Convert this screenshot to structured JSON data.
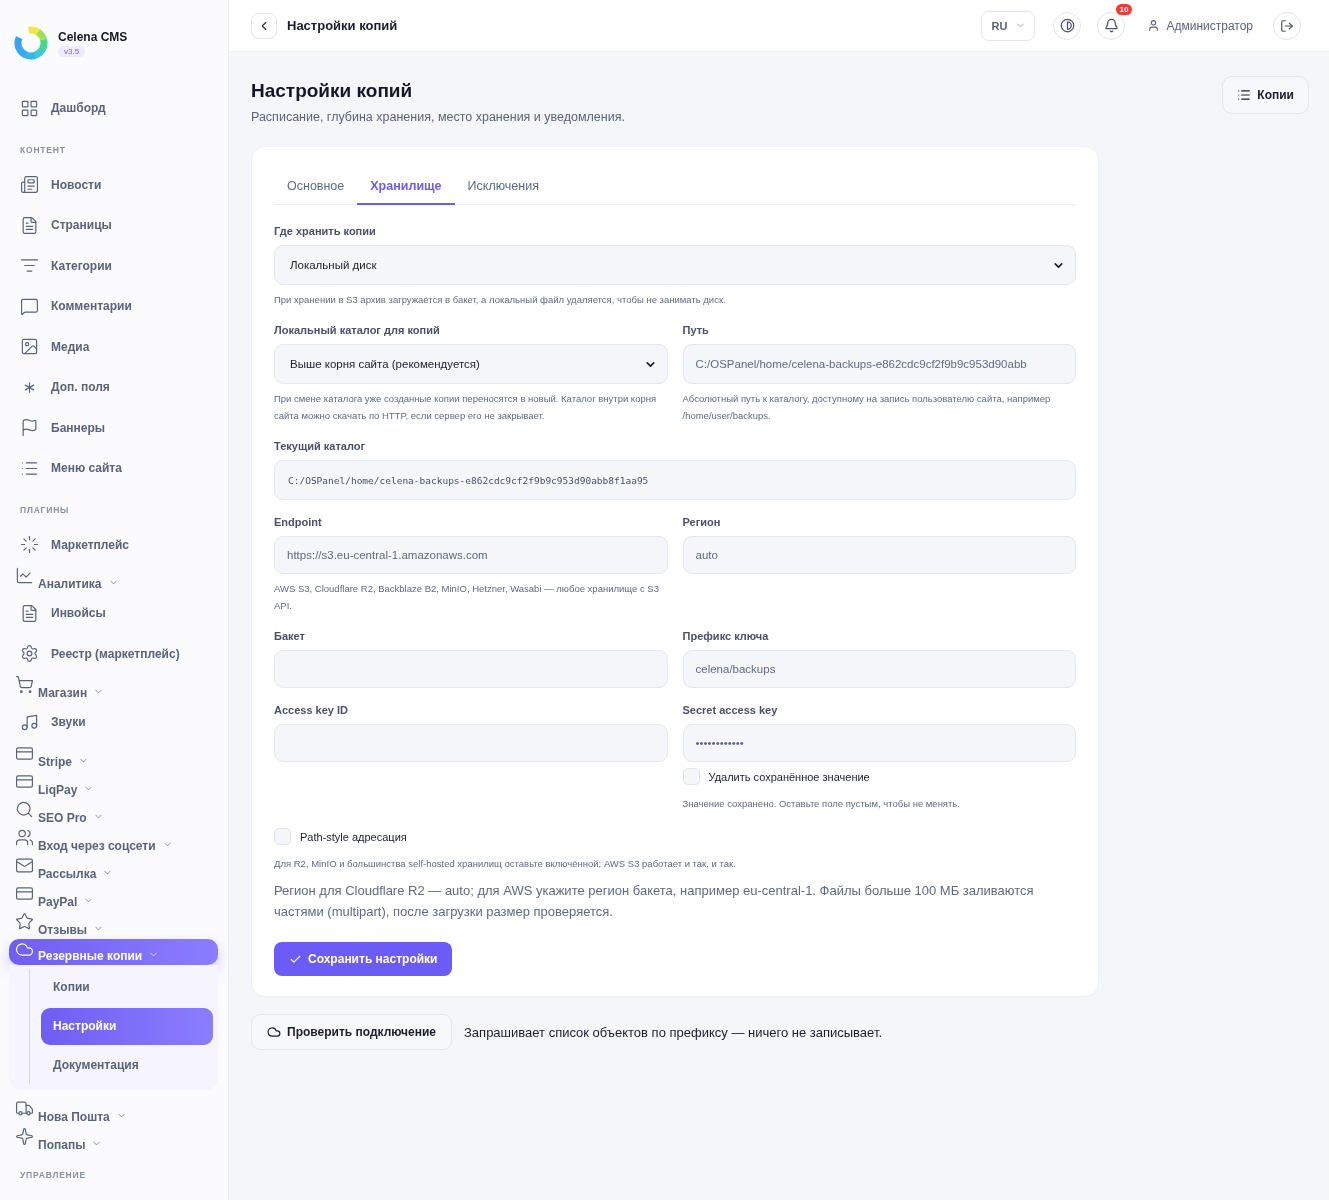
{
  "sidebar": {
    "brand": {
      "name": "Celena CMS",
      "version": "v3.5"
    },
    "sections": [
      {
        "items": [
          {
            "kind": "link",
            "label": "Дашборд",
            "selected": false
          }
        ]
      },
      {
        "heading": "КОНТЕНТ",
        "items": [
          {
            "kind": "link",
            "label": "Новости",
            "selected": false
          },
          {
            "kind": "link",
            "label": "Страницы",
            "selected": false
          },
          {
            "kind": "link",
            "label": "Категории",
            "selected": false
          },
          {
            "kind": "link",
            "label": "Комментарии",
            "selected": false
          },
          {
            "kind": "link",
            "label": "Медиа",
            "selected": false
          },
          {
            "kind": "link",
            "label": "Доп. поля",
            "selected": false
          },
          {
            "kind": "link",
            "label": "Баннеры",
            "selected": false
          },
          {
            "kind": "link",
            "label": "Меню сайта",
            "selected": false
          }
        ]
      },
      {
        "heading": "ПЛАГИНЫ",
        "items": [
          {
            "kind": "link",
            "label": "Маркетплейс",
            "selected": false
          },
          {
            "kind": "group",
            "label": "Аналитика",
            "selected": false
          },
          {
            "kind": "link",
            "label": "Инвойсы",
            "selected": false
          },
          {
            "kind": "link",
            "label": "Реестр (маркетплейс)",
            "selected": false
          },
          {
            "kind": "group",
            "label": "Магазин",
            "selected": false
          },
          {
            "kind": "link",
            "label": "Звуки",
            "selected": false
          },
          {
            "kind": "group",
            "label": "Stripe",
            "selected": false
          },
          {
            "kind": "group",
            "label": "LiqPay",
            "selected": false
          },
          {
            "kind": "group",
            "label": "SEO Pro",
            "selected": false
          },
          {
            "kind": "group",
            "label": "Вход через соцсети",
            "selected": false
          },
          {
            "kind": "group",
            "label": "Рассылка",
            "selected": false
          },
          {
            "kind": "group",
            "label": "PayPal",
            "selected": false
          },
          {
            "kind": "group",
            "label": "Отзывы",
            "selected": false
          },
          {
            "kind": "group",
            "label": "Резервные копии",
            "selected": true,
            "children": [
              {
                "label": "Копии",
                "selected": false
              },
              {
                "label": "Настройки",
                "selected": true
              },
              {
                "label": "Документация",
                "selected": false
              }
            ]
          },
          {
            "kind": "group",
            "label": "Нова Пошта",
            "selected": false
          },
          {
            "kind": "group",
            "label": "Попапы",
            "selected": false
          }
        ]
      },
      {
        "heading": "УПРАВЛЕНИЕ"
      }
    ]
  },
  "topbar": {
    "title": "Настройки копий",
    "language": "RU",
    "notifications": "10",
    "user": "Администратор"
  },
  "page": {
    "title": "Настройки копий",
    "subtitle": "Расписание, глубина хранения, место хранения и уведомления.",
    "copies_button": "Копии"
  },
  "tabs": [
    {
      "label": "Основное",
      "selected": false
    },
    {
      "label": "Хранилище",
      "selected": true
    },
    {
      "label": "Исключения",
      "selected": false
    }
  ],
  "form": {
    "storage": {
      "label": "Где хранить копии",
      "value": "Локальный диск",
      "hint": "При хранении в S3 архив загружается в бакет, а локальный файл удаляется, чтобы не занимать диск."
    },
    "local_dir": {
      "label": "Локальный каталог для копий",
      "value": "Выше корня сайта (рекомендуется)",
      "hint": "При смене каталога уже созданные копии переносятся в новый. Каталог внутри корня сайта можно скачать по HTTP, если сервер его не закрывает."
    },
    "path": {
      "label": "Путь",
      "value": "C:/OSPanel/home/celena-backups-e862cdc9cf2f9b9c953d90abb",
      "hint": "Абсолютный путь к каталогу, доступному на запись пользователю сайта, например /home/user/backups."
    },
    "current_dir": {
      "label": "Текущий каталог",
      "value": "C:/OSPanel/home/celena-backups-e862cdc9cf2f9b9c953d90abb8f1aa95"
    },
    "endpoint": {
      "label": "Endpoint",
      "value": "https://s3.eu-central-1.amazonaws.com",
      "hint": "AWS S3, Cloudflare R2, Backblaze B2, MinIO, Hetzner, Wasabi — любое хранилище с S3 API."
    },
    "region": {
      "label": "Регион",
      "value": "auto"
    },
    "bucket": {
      "label": "Бакет"
    },
    "key_prefix": {
      "label": "Префикс ключа",
      "value": "celena/backups"
    },
    "access_key_id": {
      "label": "Access key ID"
    },
    "secret_access_key": {
      "label": "Secret access key",
      "value": "••••••••••••",
      "delete_label": "Удалить сохранённое значение",
      "delete_checked": false,
      "hint": "Значение сохранено. Оставьте поле пустым, чтобы не менять."
    },
    "path_style": {
      "label": "Path-style адресация",
      "checked": false,
      "hint": "Для R2, MinIO и большинства self-hosted хранилищ оставьте включённой; AWS S3 работает и так, и так."
    },
    "note": "Регион для Cloudflare R2 — auto; для AWS укажите регион бакета, например eu-central-1. Файлы больше 100 МБ заливаются частями (multipart), после загрузки размер проверяется.",
    "save_button": "Сохранить настройки"
  },
  "footer": {
    "test_button": "Проверить подключение",
    "note": "Запрашивает список объектов по префиксу — ничего не записывает."
  }
}
